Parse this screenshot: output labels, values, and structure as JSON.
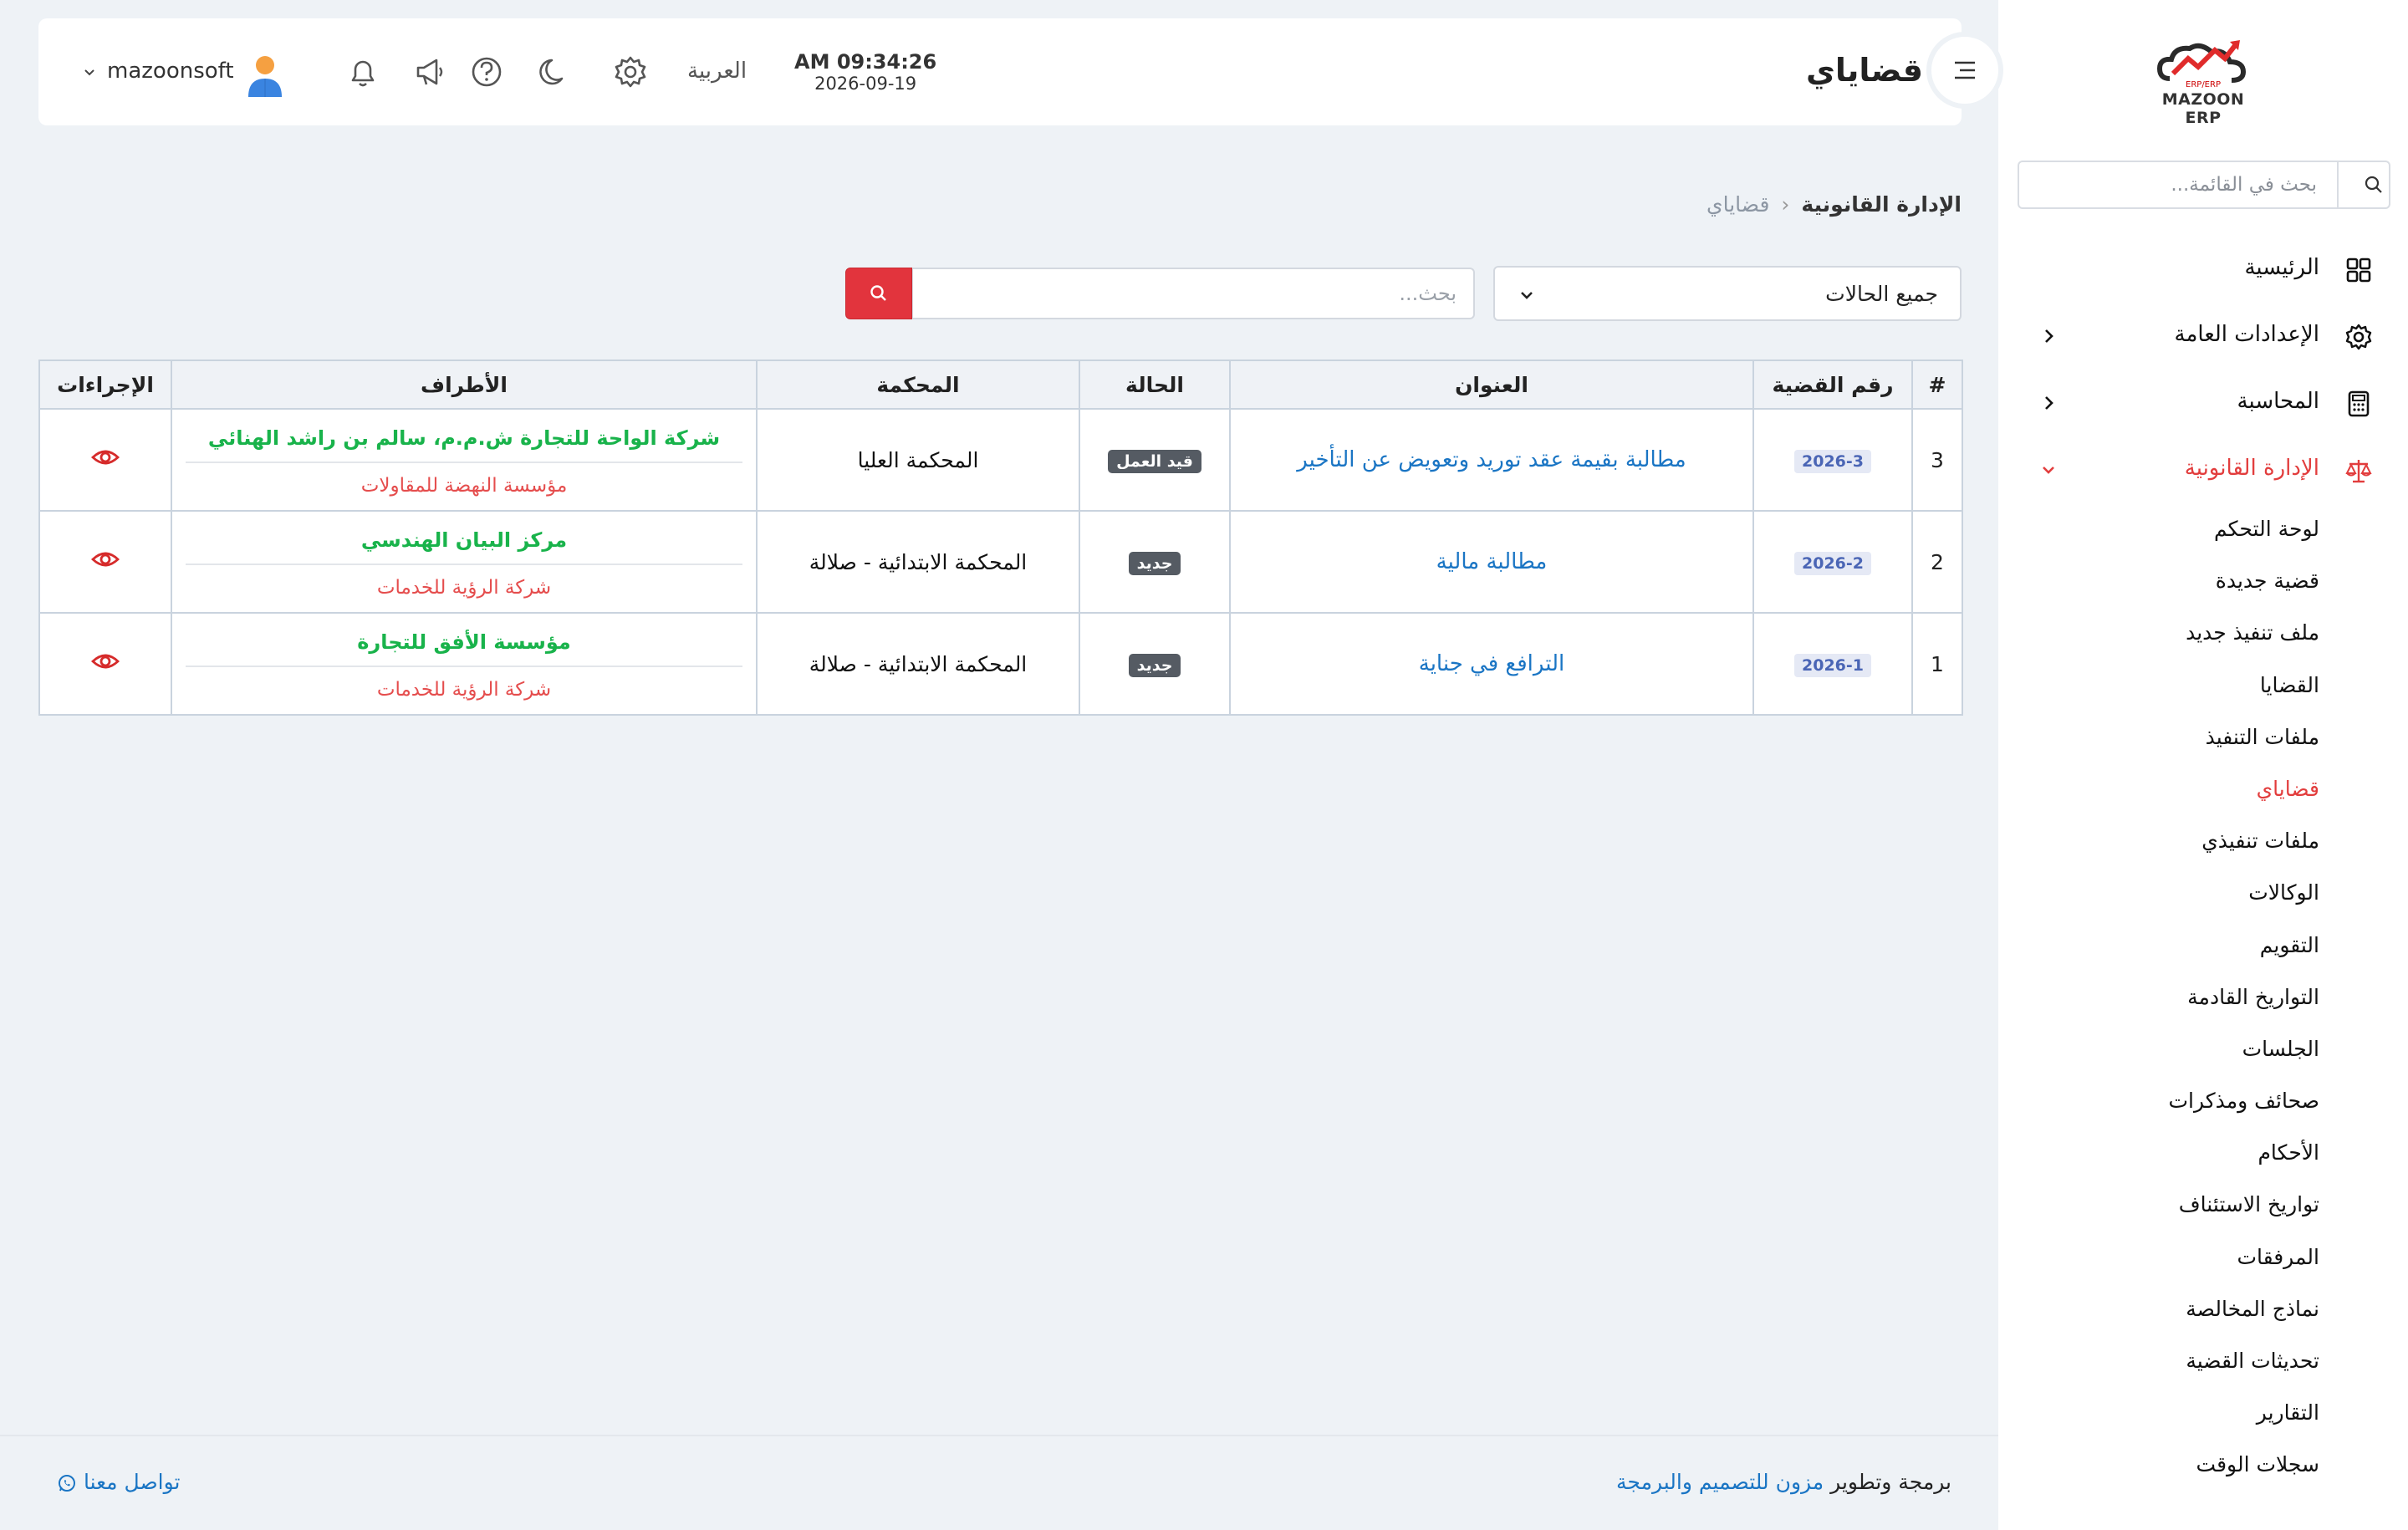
{
  "app": {
    "logo_text": "MAZOON ERP",
    "logo_subtext": "ERP/ERP"
  },
  "sidebar": {
    "search_placeholder": "بحث في القائمة...",
    "items": [
      {
        "label": "الرئيسية",
        "icon": "grid-icon",
        "has_arrow": false
      },
      {
        "label": "الإعدادات العامة",
        "icon": "gear-icon",
        "has_arrow": true
      },
      {
        "label": "المحاسبة",
        "icon": "calculator-icon",
        "has_arrow": true
      },
      {
        "label": "الإدارة القانونية",
        "icon": "scale-icon",
        "has_arrow": true,
        "active": true
      }
    ],
    "submenu": [
      "لوحة التحكم",
      "قضية جديدة",
      "ملف تنفيذ جديد",
      "القضايا",
      "ملفات التنفيذ",
      "قضاياي",
      "ملفات تنفيذي",
      "الوكالات",
      "التقويم",
      "التواريخ القادمة",
      "الجلسات",
      "صحائف ومذكرات",
      "الأحكام",
      "تواريخ الاستئناف",
      "المرفقات",
      "نماذج المخالصة",
      "تحديثات القضية",
      "التقارير",
      "سجلات الوقت"
    ],
    "submenu_active_index": 5
  },
  "header": {
    "title": "قضاياي",
    "time": "AM 09:34:26",
    "date": "2026-09-19",
    "language": "العربية",
    "username": "mazoonsoft",
    "icons": [
      "settings-icon",
      "moon-icon",
      "help-icon",
      "megaphone-icon",
      "bell-icon"
    ]
  },
  "breadcrumb": {
    "parent": "الإدارة القانونية",
    "current": "قضاياي"
  },
  "filters": {
    "status_selected": "جميع الحالات",
    "search_placeholder": "بحث..."
  },
  "table": {
    "headers": {
      "index": "#",
      "case_no": "رقم القضية",
      "title": "العنوان",
      "status": "الحالة",
      "court": "المحكمة",
      "parties": "الأطراف",
      "actions": "الإجراءات"
    },
    "rows": [
      {
        "index": "3",
        "case_no": "2026-3",
        "title": "مطالبة بقيمة عقد توريد وتعويض عن التأخير",
        "status": "قيد العمل",
        "court": "المحكمة العليا",
        "party_a": "شركة الواحة للتجارة ش.م.م، سالم بن راشد الهنائي",
        "party_b": "مؤسسة النهضة للمقاولات"
      },
      {
        "index": "2",
        "case_no": "2026-2",
        "title": "مطالبة مالية",
        "status": "جديد",
        "court": "المحكمة الابتدائية - صلالة",
        "party_a": "مركز البيان الهندسي",
        "party_b": "شركة الرؤية للخدمات"
      },
      {
        "index": "1",
        "case_no": "2026-1",
        "title": "الترافع في جناية",
        "status": "جديد",
        "court": "المحكمة الابتدائية - صلالة",
        "party_a": "مؤسسة الأفق للتجارة",
        "party_b": "شركة الرؤية للخدمات"
      }
    ]
  },
  "footer": {
    "credit_prefix": "برمجة وتطوير",
    "credit_brand": "مزون للتصميم والبرمجة",
    "contact": "تواصل معنا"
  },
  "colors": {
    "accent_red": "#e2343d",
    "link_blue": "#1a75c4",
    "party_green": "#19b34b",
    "party_red": "#e54d4d"
  }
}
